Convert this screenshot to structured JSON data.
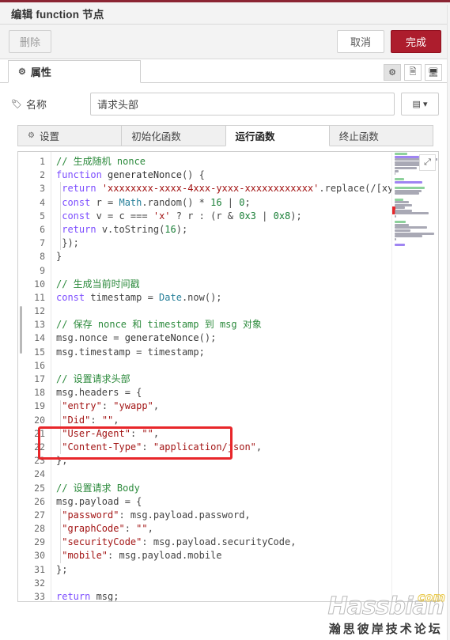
{
  "window": {
    "title": "编辑 function 节点",
    "accent_color": "#8b2533"
  },
  "actionbar": {
    "delete_label": "删除",
    "cancel_label": "取消",
    "confirm_label": "完成",
    "confirm_color": "#ad1d2d"
  },
  "tabbar": {
    "main_tab_label": "属性",
    "gear_icon": "⚙",
    "icons": [
      {
        "name": "gear-icon",
        "glyph": "⚙",
        "active": true
      },
      {
        "name": "document-icon",
        "glyph": "🗎",
        "active": false
      },
      {
        "name": "layout-icon",
        "glyph": "🖥",
        "active": false
      }
    ]
  },
  "name_field": {
    "label": "名称",
    "tag_icon": "🏷",
    "value": "请求头部",
    "placeholder": "名称",
    "dropdown_icon": "▤",
    "dropdown_caret": "▾"
  },
  "subtabs": [
    {
      "label": "设置",
      "icon": "⚙",
      "active": false
    },
    {
      "label": "初始化函数",
      "icon": "",
      "active": false
    },
    {
      "label": "运行函数",
      "icon": "",
      "active": true
    },
    {
      "label": "终止函数",
      "icon": "",
      "active": false
    }
  ],
  "editor": {
    "first_line": 1,
    "last_line": 33,
    "lines": [
      {
        "n": 1,
        "tokens": [
          {
            "t": "// 生成随机 nonce",
            "c": "com"
          }
        ]
      },
      {
        "n": 2,
        "tokens": [
          {
            "t": "function ",
            "c": "kw"
          },
          {
            "t": "generateNonce",
            "c": "fn"
          },
          {
            "t": "() {",
            "c": "pun"
          }
        ]
      },
      {
        "n": 3,
        "tokens": [
          {
            "t": " ",
            "c": "pun"
          },
          {
            "t": "return",
            "c": "kw"
          },
          {
            "t": " ",
            "c": "pun"
          },
          {
            "t": "'xxxxxxxx-xxxx-4xxx-yxxx-xxxxxxxxxxxx'",
            "c": "str"
          },
          {
            "t": ".replace(/[xy].",
            "c": "pun"
          }
        ]
      },
      {
        "n": 4,
        "tokens": [
          {
            "t": " ",
            "c": "pun"
          },
          {
            "t": "const",
            "c": "kw"
          },
          {
            "t": " r = ",
            "c": "pun"
          },
          {
            "t": "Math",
            "c": "cls"
          },
          {
            "t": ".random() * ",
            "c": "pun"
          },
          {
            "t": "16",
            "c": "num"
          },
          {
            "t": " | ",
            "c": "pun"
          },
          {
            "t": "0",
            "c": "num"
          },
          {
            "t": ";",
            "c": "pun"
          }
        ]
      },
      {
        "n": 5,
        "tokens": [
          {
            "t": " ",
            "c": "pun"
          },
          {
            "t": "const",
            "c": "kw"
          },
          {
            "t": " v = c === ",
            "c": "pun"
          },
          {
            "t": "'x'",
            "c": "str"
          },
          {
            "t": " ? r : (r & ",
            "c": "pun"
          },
          {
            "t": "0x3",
            "c": "num"
          },
          {
            "t": " | ",
            "c": "pun"
          },
          {
            "t": "0x8",
            "c": "num"
          },
          {
            "t": ");",
            "c": "pun"
          }
        ]
      },
      {
        "n": 6,
        "tokens": [
          {
            "t": " ",
            "c": "pun"
          },
          {
            "t": "return",
            "c": "kw"
          },
          {
            "t": " v.toString(",
            "c": "pun"
          },
          {
            "t": "16",
            "c": "num"
          },
          {
            "t": ");",
            "c": "pun"
          }
        ]
      },
      {
        "n": 7,
        "tokens": [
          {
            "t": " });",
            "c": "pun"
          }
        ]
      },
      {
        "n": 8,
        "tokens": [
          {
            "t": "}",
            "c": "pun"
          }
        ]
      },
      {
        "n": 9,
        "tokens": []
      },
      {
        "n": 10,
        "tokens": [
          {
            "t": "// 生成当前时间戳",
            "c": "com"
          }
        ]
      },
      {
        "n": 11,
        "tokens": [
          {
            "t": "const",
            "c": "kw"
          },
          {
            "t": " timestamp = ",
            "c": "pun"
          },
          {
            "t": "Date",
            "c": "cls"
          },
          {
            "t": ".now();",
            "c": "pun"
          }
        ]
      },
      {
        "n": 12,
        "tokens": []
      },
      {
        "n": 13,
        "tokens": [
          {
            "t": "// 保存 nonce 和 timestamp 到 msg 对象",
            "c": "com"
          }
        ]
      },
      {
        "n": 14,
        "tokens": [
          {
            "t": "msg.nonce = ",
            "c": "pun"
          },
          {
            "t": "generateNonce",
            "c": "fn"
          },
          {
            "t": "();",
            "c": "pun"
          }
        ]
      },
      {
        "n": 15,
        "tokens": [
          {
            "t": "msg.timestamp = timestamp;",
            "c": "pun"
          }
        ]
      },
      {
        "n": 16,
        "tokens": []
      },
      {
        "n": 17,
        "tokens": [
          {
            "t": "// 设置请求头部",
            "c": "com"
          }
        ]
      },
      {
        "n": 18,
        "tokens": [
          {
            "t": "msg.headers = {",
            "c": "pun"
          }
        ]
      },
      {
        "n": 19,
        "tokens": [
          {
            "t": " ",
            "c": "pun"
          },
          {
            "t": "\"entry\"",
            "c": "prop"
          },
          {
            "t": ": ",
            "c": "pun"
          },
          {
            "t": "\"ywapp\"",
            "c": "str"
          },
          {
            "t": ",",
            "c": "pun"
          }
        ]
      },
      {
        "n": 20,
        "tokens": [
          {
            "t": " ",
            "c": "pun"
          },
          {
            "t": "\"Did\"",
            "c": "prop"
          },
          {
            "t": ": ",
            "c": "pun"
          },
          {
            "t": "\"\"",
            "c": "str"
          },
          {
            "t": ",",
            "c": "pun"
          }
        ]
      },
      {
        "n": 21,
        "tokens": [
          {
            "t": " ",
            "c": "pun"
          },
          {
            "t": "\"User-Agent\"",
            "c": "prop"
          },
          {
            "t": ": ",
            "c": "pun"
          },
          {
            "t": "\"\"",
            "c": "str"
          },
          {
            "t": ",",
            "c": "pun"
          }
        ]
      },
      {
        "n": 22,
        "tokens": [
          {
            "t": " ",
            "c": "pun"
          },
          {
            "t": "\"Content-Type\"",
            "c": "prop"
          },
          {
            "t": ": ",
            "c": "pun"
          },
          {
            "t": "\"application/json\"",
            "c": "str"
          },
          {
            "t": ",",
            "c": "pun"
          }
        ]
      },
      {
        "n": 23,
        "tokens": [
          {
            "t": "};",
            "c": "pun"
          }
        ]
      },
      {
        "n": 24,
        "tokens": []
      },
      {
        "n": 25,
        "tokens": [
          {
            "t": "// 设置请求 Body",
            "c": "com"
          }
        ]
      },
      {
        "n": 26,
        "tokens": [
          {
            "t": "msg.payload = {",
            "c": "pun"
          }
        ]
      },
      {
        "n": 27,
        "tokens": [
          {
            "t": " ",
            "c": "pun"
          },
          {
            "t": "\"password\"",
            "c": "prop"
          },
          {
            "t": ": msg.payload.password,",
            "c": "pun"
          }
        ]
      },
      {
        "n": 28,
        "tokens": [
          {
            "t": " ",
            "c": "pun"
          },
          {
            "t": "\"graphCode\"",
            "c": "prop"
          },
          {
            "t": ": ",
            "c": "pun"
          },
          {
            "t": "\"\"",
            "c": "str"
          },
          {
            "t": ",",
            "c": "pun"
          }
        ]
      },
      {
        "n": 29,
        "tokens": [
          {
            "t": " ",
            "c": "pun"
          },
          {
            "t": "\"securityCode\"",
            "c": "prop"
          },
          {
            "t": ": msg.payload.securityCode,",
            "c": "pun"
          }
        ]
      },
      {
        "n": 30,
        "tokens": [
          {
            "t": " ",
            "c": "pun"
          },
          {
            "t": "\"mobile\"",
            "c": "prop"
          },
          {
            "t": ": msg.payload.mobile",
            "c": "pun"
          }
        ]
      },
      {
        "n": 31,
        "tokens": [
          {
            "t": "};",
            "c": "pun"
          }
        ]
      },
      {
        "n": 32,
        "tokens": []
      },
      {
        "n": 33,
        "tokens": [
          {
            "t": "return",
            "c": "kw"
          },
          {
            "t": " msg;",
            "c": "pun"
          }
        ]
      }
    ],
    "minimap_expand_icon": "⤢",
    "annotation": {
      "color": "#e8262a",
      "covers_lines": [
        20,
        21
      ]
    }
  },
  "watermark": {
    "brand": "Hassbian",
    "suffix": "com",
    "subtitle": "瀚思彼岸技术论坛"
  }
}
